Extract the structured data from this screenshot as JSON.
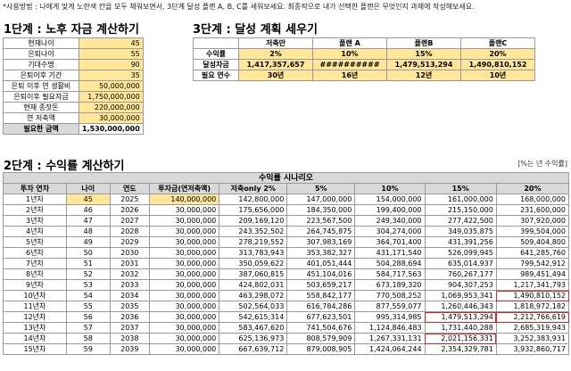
{
  "usage_text": "*사용방법 : 나에게 맞게 노란색 칸을 모두 채워보면서, 3단계 달성 플랜 A, B, C를 세워보세요. 최종적으로 내가 선택한 플랜은 무엇인지 과제에 작성해보세요.",
  "step1": {
    "title": "1단계 : 노후 자금 계산하기",
    "rows": [
      {
        "label": "현재나이",
        "value": "45"
      },
      {
        "label": "은퇴나이",
        "value": "55"
      },
      {
        "label": "기대수명",
        "value": "90"
      },
      {
        "label": "은퇴이후 기간",
        "value": "35"
      },
      {
        "label": "은퇴 이후 연 생활비",
        "value": "50,000,000"
      },
      {
        "label": "은퇴이후 필요자금",
        "value": "1,750,000,000"
      },
      {
        "label": "현재 종잣돈",
        "value": "220,000,000"
      },
      {
        "label": "연 저축액",
        "value": "30,000,000"
      }
    ],
    "total_label": "필요한 금액",
    "total_value": "1,530,000,000"
  },
  "step3": {
    "title": "3단계 : 달성 계획 세우기",
    "headers": [
      "",
      "저축만",
      "플랜 A",
      "플랜B",
      "플랜C"
    ],
    "rows": [
      {
        "label": "수익률",
        "values": [
          "2%",
          "10%",
          "15%",
          "20%"
        ]
      },
      {
        "label": "달성자금",
        "values": [
          "1,417,357,657",
          "##########",
          "1,479,513,294",
          "1,490,810,152"
        ]
      },
      {
        "label": "필요 연수",
        "values": [
          "30년",
          "16년",
          "12년",
          "10년"
        ]
      }
    ]
  },
  "step2": {
    "title": "2단계 : 수익률 계산하기",
    "unit_note": "[%는 년 수익률]",
    "section_title": "수익률 시나리오",
    "headers": [
      "투자 연차",
      "나이",
      "연도",
      "투자금(연저축액)",
      "저축only 2%",
      "5%",
      "10%",
      "15%",
      "20%"
    ],
    "rows": [
      [
        "1년차",
        "45",
        "2025",
        "140,000,000",
        "142,800,000",
        "147,000,000",
        "154,000,000",
        "161,000,000",
        "168,000,000"
      ],
      [
        "2년차",
        "46",
        "2026",
        "30,000,000",
        "175,656,000",
        "184,350,000",
        "199,400,000",
        "215,150,000",
        "231,600,000"
      ],
      [
        "3년차",
        "47",
        "2027",
        "30,000,000",
        "209,169,120",
        "223,567,500",
        "249,340,000",
        "277,422,500",
        "307,920,000"
      ],
      [
        "4년차",
        "48",
        "2028",
        "30,000,000",
        "243,352,502",
        "264,745,875",
        "304,274,000",
        "349,035,875",
        "399,504,000"
      ],
      [
        "5년차",
        "49",
        "2029",
        "30,000,000",
        "278,219,552",
        "307,983,169",
        "364,701,400",
        "431,391,256",
        "509,404,800"
      ],
      [
        "6년차",
        "50",
        "2030",
        "30,000,000",
        "313,783,943",
        "353,382,327",
        "431,171,540",
        "526,099,945",
        "641,285,760"
      ],
      [
        "7년차",
        "51",
        "2031",
        "30,000,000",
        "350,059,622",
        "401,051,444",
        "504,288,694",
        "635,014,937",
        "799,542,912"
      ],
      [
        "8년차",
        "52",
        "2032",
        "30,000,000",
        "387,060,815",
        "451,104,016",
        "584,717,563",
        "760,267,177",
        "989,451,494"
      ],
      [
        "9년차",
        "53",
        "2033",
        "30,000,000",
        "424,802,031",
        "503,659,217",
        "673,189,320",
        "904,307,253",
        "1,217,341,793"
      ],
      [
        "10년차",
        "54",
        "2034",
        "30,000,000",
        "463,298,072",
        "558,842,177",
        "770,508,252",
        "1,069,953,341",
        "1,490,810,152"
      ],
      [
        "11년차",
        "55",
        "2035",
        "30,000,000",
        "502,564,033",
        "616,784,286",
        "877,559,077",
        "1,260,446,343",
        "1,818,972,182"
      ],
      [
        "12년차",
        "56",
        "2036",
        "30,000,000",
        "542,615,314",
        "677,623,501",
        "995,314,985",
        "1,479,513,294",
        "2,212,766,619"
      ],
      [
        "13년차",
        "57",
        "2037",
        "30,000,000",
        "583,467,620",
        "741,504,676",
        "1,124,846,483",
        "1,731,440,288",
        "2,685,319,943"
      ],
      [
        "14년차",
        "58",
        "2038",
        "30,000,000",
        "625,136,973",
        "808,579,909",
        "1,267,331,131",
        "2,021,156,331",
        "3,252,383,931"
      ],
      [
        "15년차",
        "59",
        "2039",
        "30,000,000",
        "667,639,712",
        "879,008,905",
        "1,424,064,244",
        "2,354,329,781",
        "3,932,860,717"
      ]
    ]
  }
}
